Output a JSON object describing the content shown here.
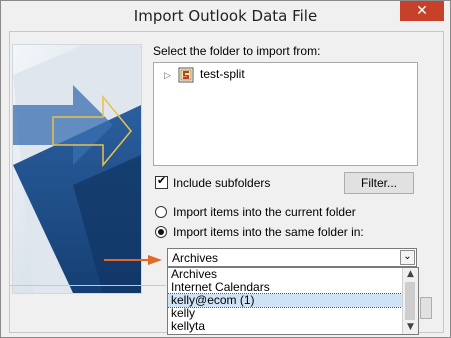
{
  "window": {
    "title": "Import Outlook Data File",
    "close_glyph": "✕"
  },
  "folder_section": {
    "label": "Select the folder to import from:",
    "tree": [
      {
        "label": "test-split",
        "icon": "pst-file-icon",
        "expand_glyph": "▷"
      }
    ]
  },
  "include_subfolders": {
    "label": "Include subfolders",
    "checked": true
  },
  "filter_button": {
    "label": "Filter..."
  },
  "import_options": [
    {
      "label": "Import items into the current folder",
      "selected": false
    },
    {
      "label": "Import items into the same folder in:",
      "selected": true
    }
  ],
  "folder_combo": {
    "value": "Archives",
    "dropdown_glyph": "⌄",
    "options": [
      "Archives",
      "Internet Calendars",
      "kelly@ecom (1)",
      "kelly",
      "kellyta"
    ],
    "highlighted": "kelly@ecom (1)"
  },
  "colors": {
    "close_red": "#c7412a",
    "highlight_blue": "#cfe3f7",
    "annotation_orange": "#e0692a"
  }
}
